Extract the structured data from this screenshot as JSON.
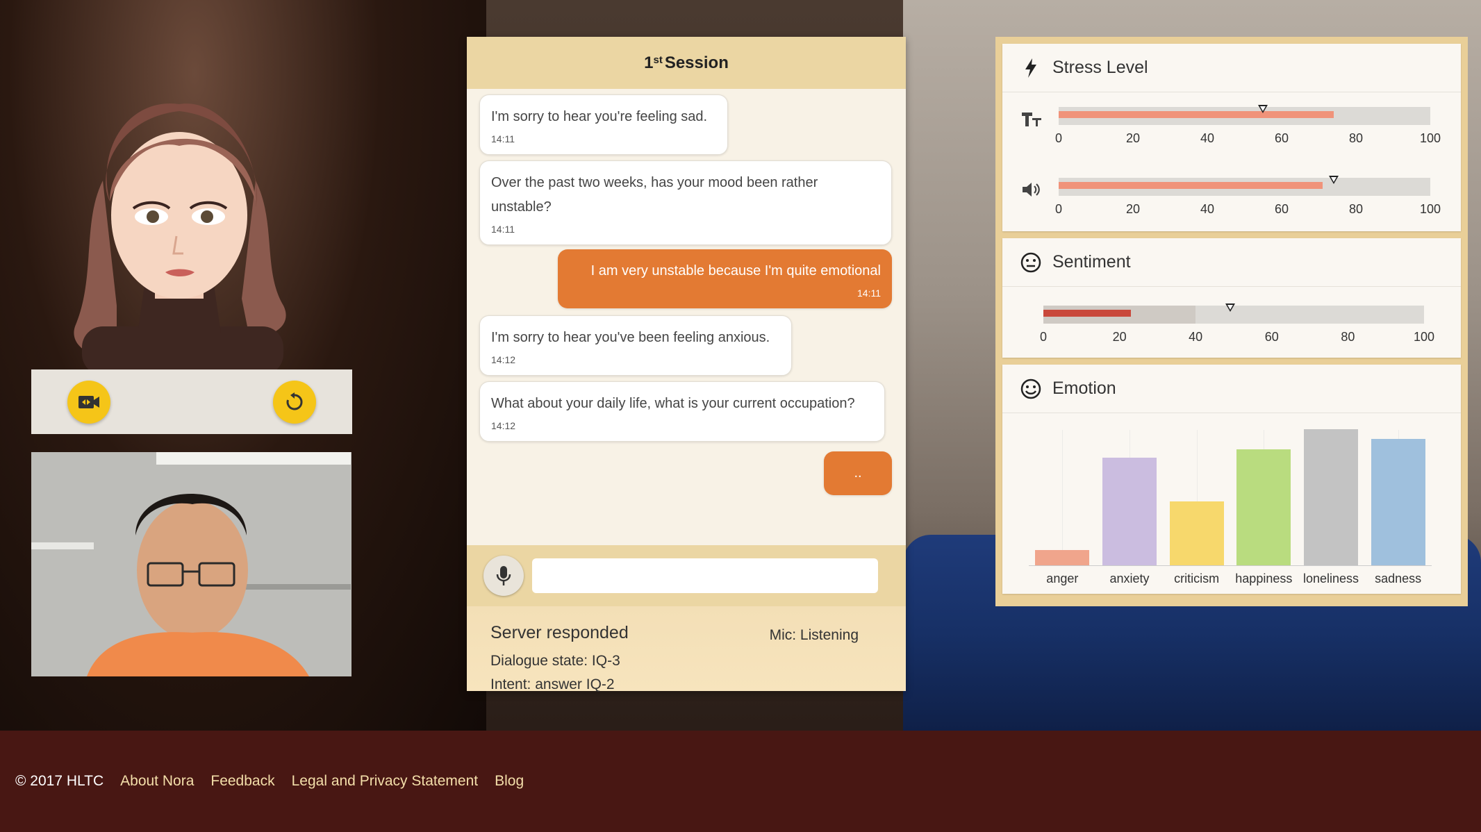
{
  "chat": {
    "header": {
      "ordinal": "1",
      "superscript": "st",
      "title": "Session"
    },
    "messages": [
      {
        "sender": "bot",
        "text": "I'm sorry to hear you're feeling sad.",
        "time": "14:11"
      },
      {
        "sender": "bot",
        "text": "Over the past two weeks, has your mood been rather unstable?",
        "time": "14:11"
      },
      {
        "sender": "user",
        "text": "I am very unstable because I'm quite emotional",
        "time": "14:11"
      },
      {
        "sender": "bot",
        "text": "I'm sorry to hear you've been feeling anxious.",
        "time": "14:12"
      },
      {
        "sender": "bot",
        "text": "What about your daily life, what is your current occupation?",
        "time": "14:12"
      },
      {
        "sender": "user",
        "text": "..",
        "time": ""
      }
    ],
    "input": {
      "value": "",
      "placeholder": ""
    }
  },
  "status": {
    "title": "Server responded",
    "mic": "Mic: Listening",
    "dialogue_state": "Dialogue state: IQ-3",
    "intent": "Intent: answer IQ-2"
  },
  "stress": {
    "title": "Stress Level",
    "icons": {
      "header": "lightning-icon",
      "text_row": "text-size-icon",
      "audio_row": "speaker-icon"
    },
    "text_fill": 74,
    "text_marker": 55,
    "audio_fill": 71,
    "audio_marker": 74,
    "ticks": [
      "0",
      "20",
      "40",
      "60",
      "80",
      "100"
    ]
  },
  "sentiment": {
    "title": "Sentiment",
    "icon": "neutral-face-icon",
    "fill": 23,
    "marker": 49,
    "neutral_band_end": 40,
    "ticks": [
      "0",
      "20",
      "40",
      "60",
      "80",
      "100"
    ]
  },
  "emotion": {
    "title": "Emotion",
    "icon": "smile-face-icon"
  },
  "chart_data": {
    "type": "bar",
    "title": "Emotion",
    "categories": [
      "anger",
      "anxiety",
      "criticism",
      "happiness",
      "loneliness",
      "sadness"
    ],
    "values": [
      0.11,
      0.79,
      0.47,
      0.85,
      1.0,
      0.93
    ],
    "colors": [
      "#f0a58c",
      "#cbbde0",
      "#f7d86c",
      "#b9dc7f",
      "#c3c3c3",
      "#9fc0dd"
    ],
    "ylim": [
      0,
      1
    ],
    "grid": true
  },
  "controls": {
    "camera_icon": "camera-switch-icon",
    "reset_icon": "refresh-icon"
  },
  "colors": {
    "accent": "#e37a33",
    "header": "#ebd6a3",
    "footer": "#481713",
    "button": "#f5c518",
    "stress_fill": "#f0937a",
    "sentiment_fill": "#c9483b"
  },
  "footer": {
    "copyright": "© 2017 HLTC",
    "links": [
      "About Nora",
      "Feedback",
      "Legal and Privacy Statement",
      "Blog"
    ]
  }
}
